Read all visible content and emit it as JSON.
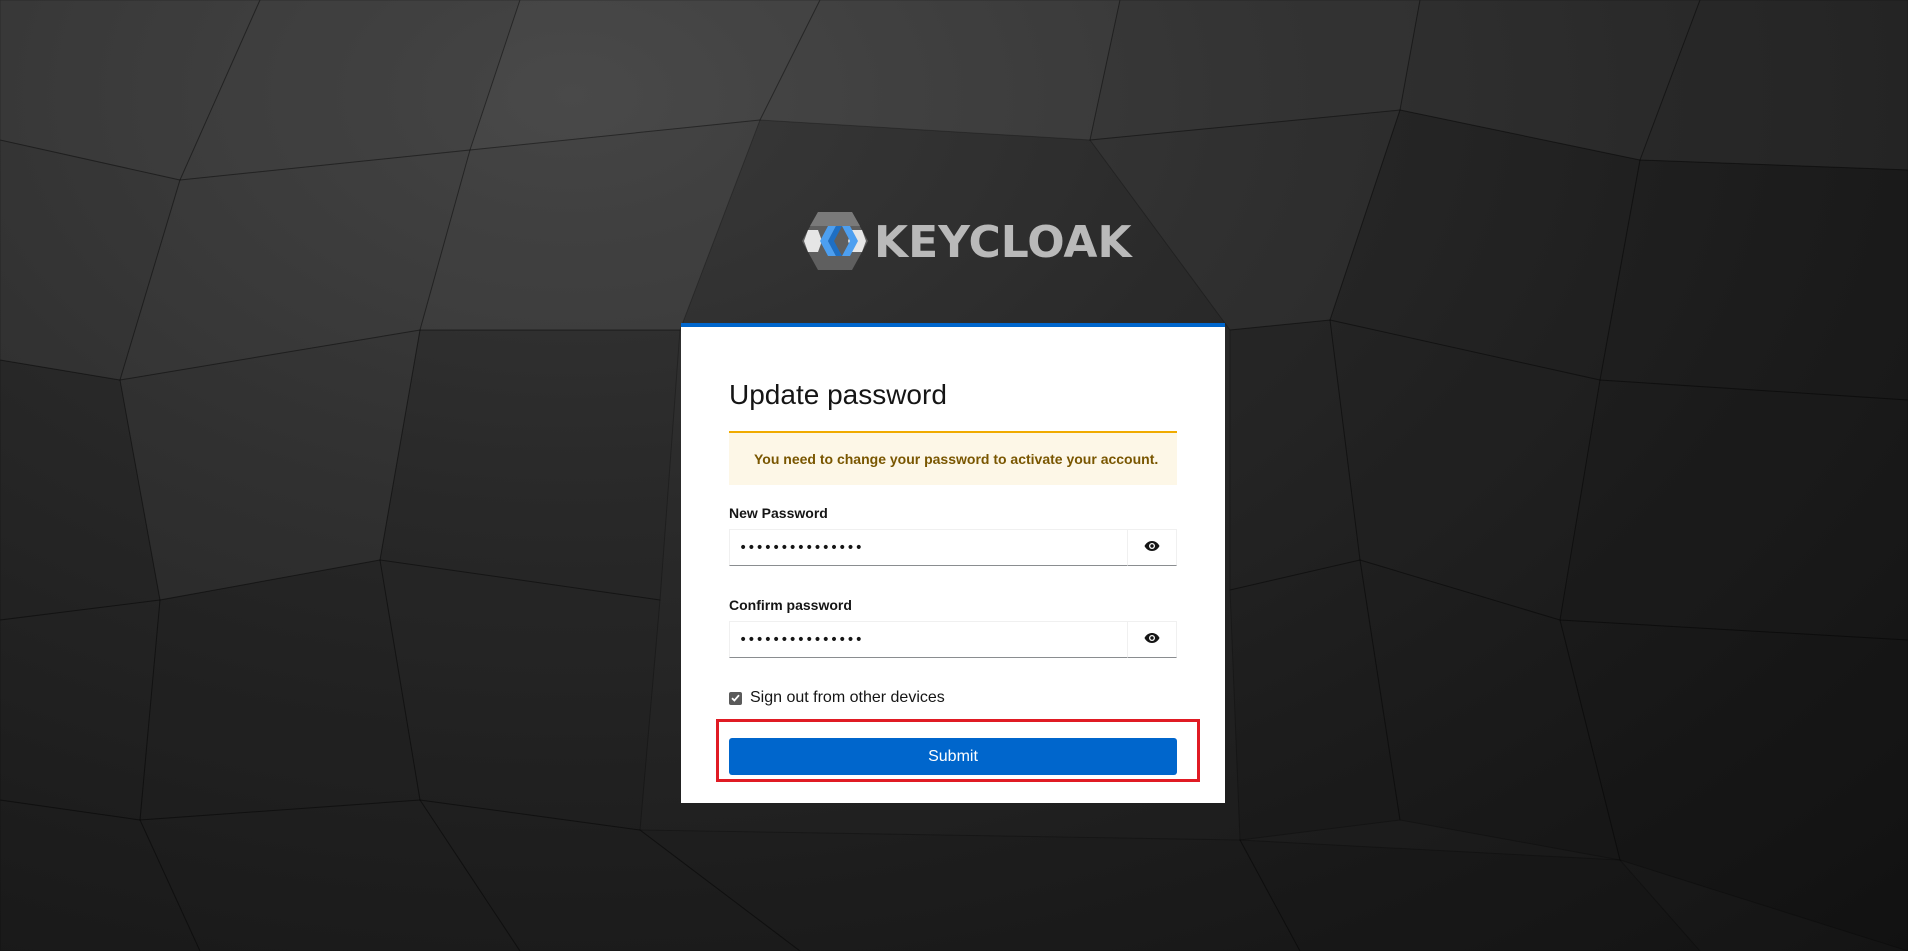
{
  "logo": {
    "text": "KEYCLOAK",
    "icon": "keycloak-logo-icon"
  },
  "card": {
    "title": "Update password",
    "alert": "You need to change your password to activate your account.",
    "new_password": {
      "label": "New Password",
      "value": "•••••••••••••••",
      "toggle_icon": "eye-icon"
    },
    "confirm_password": {
      "label": "Confirm password",
      "value": "•••••••••••••••",
      "toggle_icon": "eye-icon"
    },
    "sign_out_checkbox": {
      "label": "Sign out from other devices",
      "checked": true
    },
    "submit_label": "Submit"
  },
  "colors": {
    "primary": "#0066cc",
    "alert_bg": "#fdf7e7",
    "alert_border": "#f0ab00",
    "alert_text": "#795600",
    "highlight": "#e01b24"
  }
}
